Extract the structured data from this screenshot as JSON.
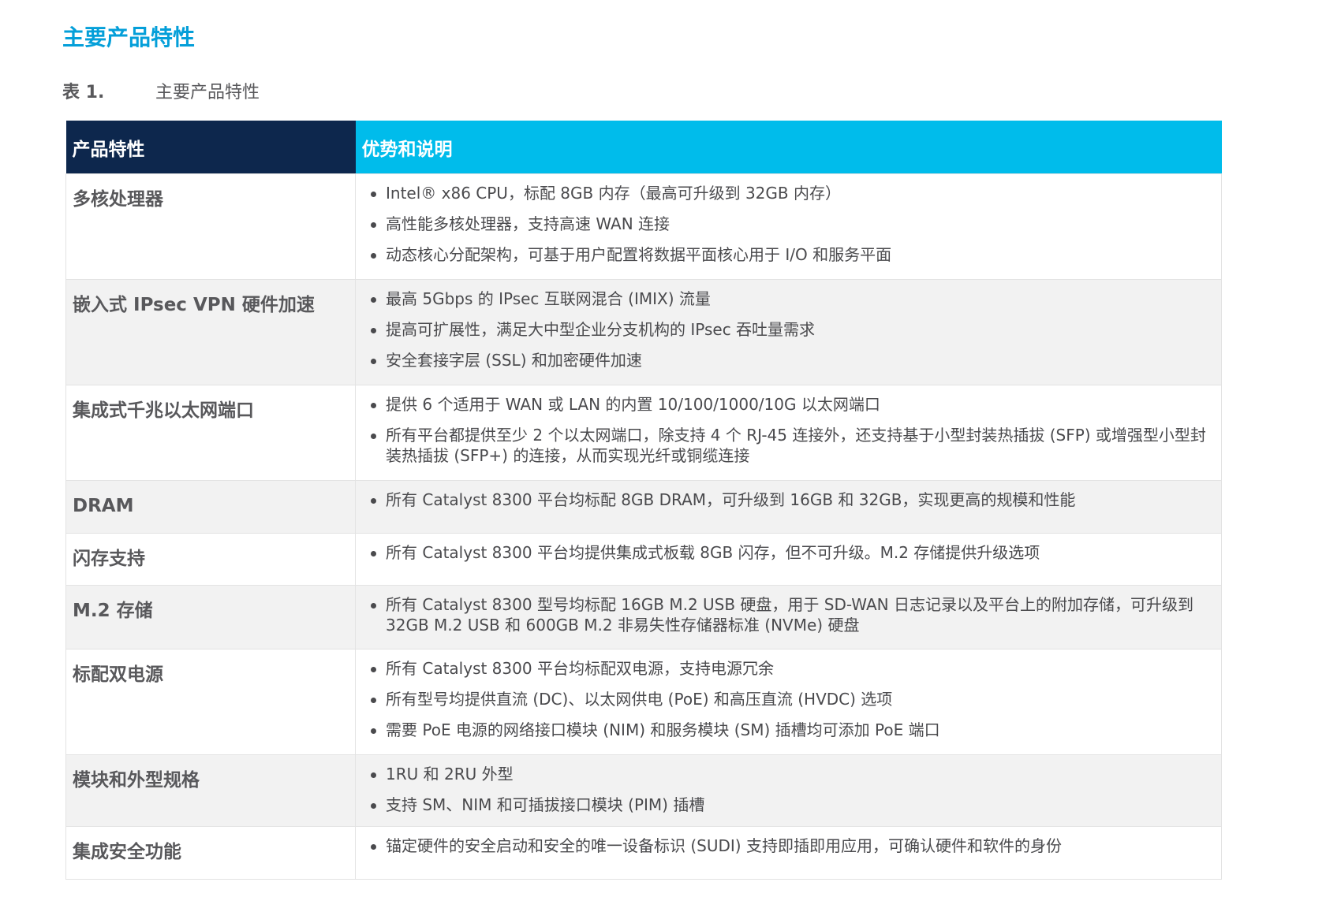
{
  "section_title": "主要产品特性",
  "caption": {
    "number": "表 1.",
    "title": "主要产品特性"
  },
  "table": {
    "headers": [
      "产品特性",
      "优势和说明"
    ],
    "rows": [
      {
        "feature": "多核处理器",
        "bullets": [
          "Intel® x86 CPU，标配 8GB 内存（最高可升级到 32GB 内存）",
          "高性能多核处理器，支持高速 WAN 连接",
          "动态核心分配架构，可基于用户配置将数据平面核心用于 I/O 和服务平面"
        ]
      },
      {
        "feature": "嵌入式 IPsec VPN 硬件加速",
        "bullets": [
          "最高 5Gbps 的 IPsec 互联网混合 (IMIX) 流量",
          "提高可扩展性，满足大中型企业分支机构的 IPsec 吞吐量需求",
          "安全套接字层 (SSL) 和加密硬件加速"
        ]
      },
      {
        "feature": "集成式千兆以太网端口",
        "bullets": [
          "提供 6 个适用于 WAN 或 LAN 的内置 10/100/1000/10G 以太网端口",
          "所有平台都提供至少 2 个以太网端口，除支持 4 个 RJ-45 连接外，还支持基于小型封装热插拔 (SFP) 或增强型小型封装热插拔 (SFP+) 的连接，从而实现光纤或铜缆连接"
        ]
      },
      {
        "feature": "DRAM",
        "bullets": [
          "所有 Catalyst 8300 平台均标配 8GB DRAM，可升级到 16GB 和 32GB，实现更高的规模和性能"
        ]
      },
      {
        "feature": "闪存支持",
        "bullets": [
          "所有 Catalyst 8300 平台均提供集成式板载 8GB 闪存，但不可升级。M.2 存储提供升级选项"
        ]
      },
      {
        "feature": "M.2 存储",
        "bullets": [
          "所有 Catalyst 8300 型号均标配 16GB M.2 USB 硬盘，用于 SD-WAN 日志记录以及平台上的附加存储，可升级到 32GB M.2 USB 和 600GB M.2 非易失性存储器标准 (NVMe) 硬盘"
        ]
      },
      {
        "feature": "标配双电源",
        "bullets": [
          "所有 Catalyst 8300 平台均标配双电源，支持电源冗余",
          "所有型号均提供直流 (DC)、以太网供电 (PoE) 和高压直流 (HVDC) 选项",
          "需要 PoE 电源的网络接口模块 (NIM) 和服务模块 (SM) 插槽均可添加 PoE 端口"
        ]
      },
      {
        "feature": "模块和外型规格",
        "bullets": [
          "1RU 和 2RU 外型",
          "支持 SM、NIM 和可插拔接口模块 (PIM) 插槽"
        ]
      },
      {
        "feature": "集成安全功能",
        "bullets": [
          "锚定硬件的安全启动和安全的唯一设备标识 (SUDI) 支持即插即用应用，可确认硬件和软件的身份"
        ]
      }
    ]
  }
}
